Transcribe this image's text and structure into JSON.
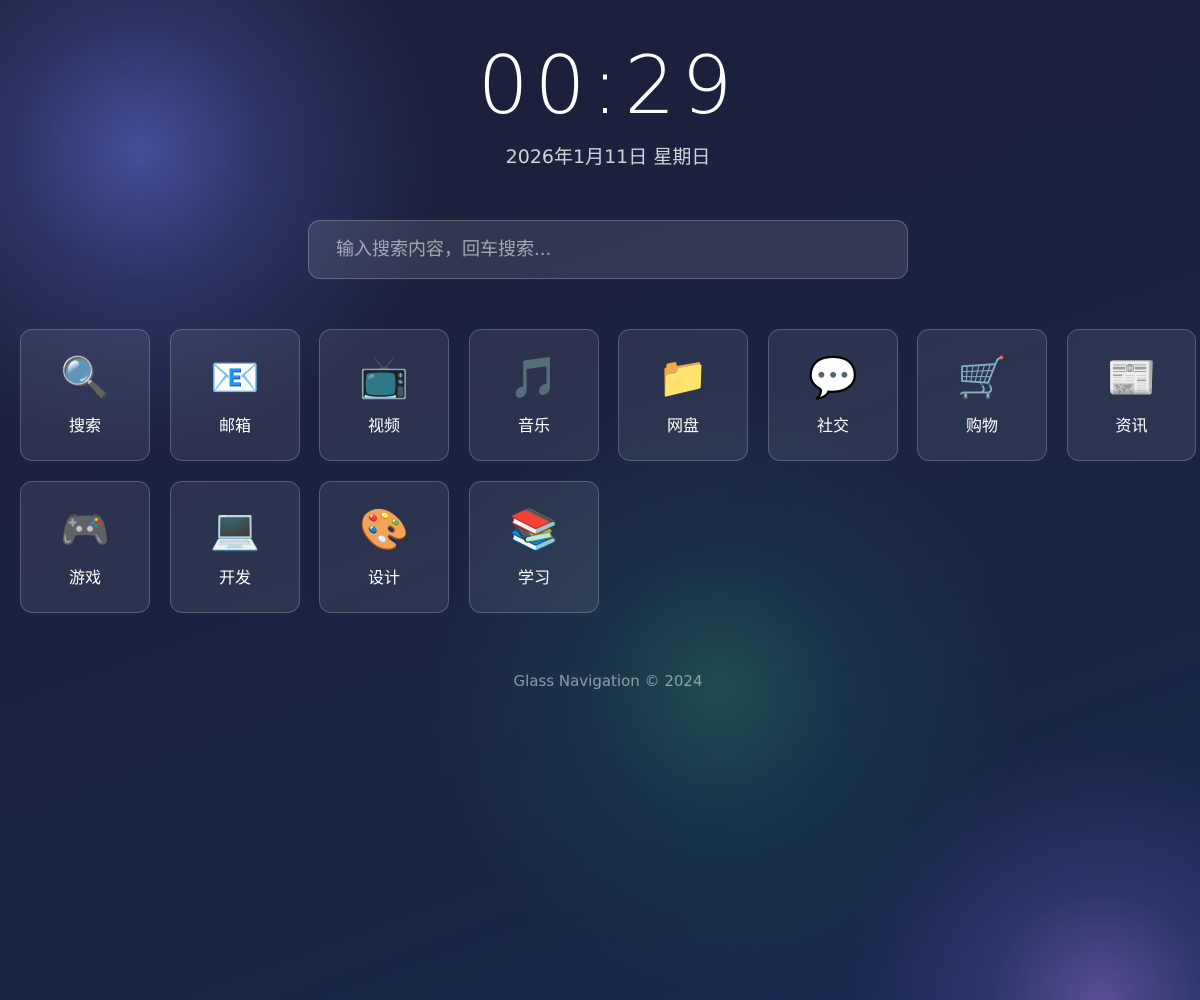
{
  "clock": {
    "time": "00:29"
  },
  "date": {
    "text": "2026年1月11日 星期日"
  },
  "search": {
    "placeholder": "输入搜索内容，回车搜索..."
  },
  "tiles": [
    {
      "label": "搜索",
      "icon": "🔍",
      "icon_name": "magnifier-icon"
    },
    {
      "label": "邮箱",
      "icon": "📧",
      "icon_name": "email-icon"
    },
    {
      "label": "视频",
      "icon": "📺",
      "icon_name": "tv-icon"
    },
    {
      "label": "音乐",
      "icon": "🎵",
      "icon_name": "music-note-icon"
    },
    {
      "label": "网盘",
      "icon": "📁",
      "icon_name": "folder-icon"
    },
    {
      "label": "社交",
      "icon": "💬",
      "icon_name": "speech-bubble-icon"
    },
    {
      "label": "购物",
      "icon": "🛒",
      "icon_name": "shopping-cart-icon"
    },
    {
      "label": "资讯",
      "icon": "📰",
      "icon_name": "newspaper-icon"
    },
    {
      "label": "游戏",
      "icon": "🎮",
      "icon_name": "gamepad-icon"
    },
    {
      "label": "开发",
      "icon": "💻",
      "icon_name": "laptop-icon"
    },
    {
      "label": "设计",
      "icon": "🎨",
      "icon_name": "palette-icon"
    },
    {
      "label": "学习",
      "icon": "📚",
      "icon_name": "books-icon"
    }
  ],
  "footer": {
    "text": "Glass Navigation © 2024"
  }
}
